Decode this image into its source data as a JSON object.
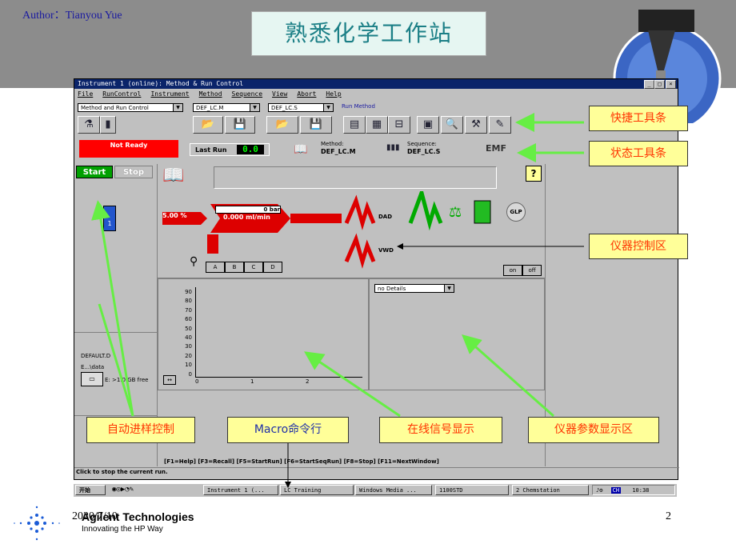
{
  "slide": {
    "author": "Author：Tianyou Yue",
    "title": "熟悉化学工作站",
    "date": "2020/7/10",
    "page": "2",
    "brand": "Agilent Technologies",
    "tagline": "Innovating the HP Way"
  },
  "window": {
    "title": "Instrument 1 (online): Method & Run Control",
    "min_label": "_",
    "max_label": "□",
    "close_label": "×",
    "menu": [
      "File",
      "RunControl",
      "Instrument",
      "Method",
      "Sequence",
      "View",
      "Abort",
      "Help"
    ]
  },
  "toolbar": {
    "view_combo": "Method and Run Control",
    "method_combo": "DEF_LC.M",
    "sequence_combo": "DEF_LC.S",
    "run_method_label": "Run Method"
  },
  "status": {
    "not_ready": "Not Ready",
    "last_run_label": "Last Run",
    "last_run_value": "0.0",
    "method_label": "Method:",
    "method_value": "DEF_LC.M",
    "sequence_label": "Sequence:",
    "sequence_value": "DEF_LC.S",
    "emf": "EMF"
  },
  "left_panel": {
    "start": "Start",
    "stop": "Stop",
    "vial_number": "1",
    "data_file": "DEFAULT.D",
    "data_path": "E...\\data",
    "disk_free": "E: >1.0 GB free"
  },
  "control": {
    "help": "?",
    "pump_pct": "5.00 %",
    "pressure": "0 bar",
    "flow": "0.000 ml/min",
    "dad": "DAD",
    "vwd": "VWD",
    "glp": "GLP",
    "solvents": [
      "A",
      "B",
      "C",
      "D"
    ],
    "on": "on",
    "off": "off"
  },
  "signal": {
    "y_ticks": [
      "90",
      "80",
      "70",
      "60",
      "50",
      "40",
      "30",
      "20",
      "10",
      "0"
    ],
    "x_ticks": [
      "0",
      "1",
      "2"
    ],
    "details_combo": "no Details"
  },
  "function_keys": "[F1=Help] [F3=Recall] [F5=StartRun] [F6=StartSeqRun] [F8=Stop] [F11=NextWindow]",
  "status_line": "Click to stop the current run.",
  "taskbar": {
    "start": "开始",
    "items": [
      "Instrument 1 (...",
      "LC Training",
      "Windows Media ...",
      "1100STD",
      "2 Chemstation"
    ],
    "ime": "CH",
    "clock": "10:38"
  },
  "callouts": {
    "quick_toolbar": "快捷工具条",
    "status_toolbar": "状态工具条",
    "instrument_control": "仪器控制区",
    "auto_sampler": "自动进样控制",
    "macro": "Macro命令行",
    "online_signal": "在线信号显示",
    "instrument_params": "仪器参数显示区"
  },
  "colors": {
    "header_bg": "#8c8c8c",
    "title_bar": "#0a246a",
    "not_ready": "#ff0000",
    "callout_bg": "#ffff99",
    "callout_text": "#ff3300",
    "arrow": "#66ee44"
  }
}
